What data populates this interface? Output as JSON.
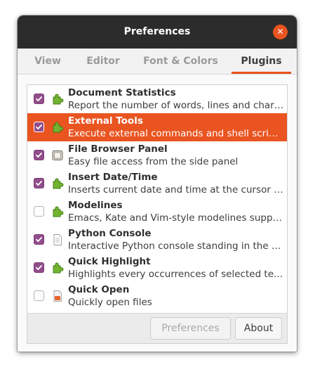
{
  "window": {
    "title": "Preferences"
  },
  "tabs": [
    {
      "label": "View",
      "active": false
    },
    {
      "label": "Editor",
      "active": false
    },
    {
      "label": "Font & Colors",
      "active": false
    },
    {
      "label": "Plugins",
      "active": true
    }
  ],
  "plugins": [
    {
      "name": "Document Statistics",
      "description": "Report the number of words, lines and characters",
      "enabled": true,
      "selected": false,
      "icon": "puzzle-icon"
    },
    {
      "name": "External Tools",
      "description": "Execute external commands and shell scripts.",
      "enabled": true,
      "selected": true,
      "icon": "puzzle-icon"
    },
    {
      "name": "File Browser Panel",
      "description": "Easy file access from the side panel",
      "enabled": true,
      "selected": false,
      "icon": "panel-icon"
    },
    {
      "name": "Insert Date/Time",
      "description": "Inserts current date and time at the cursor position.",
      "enabled": true,
      "selected": false,
      "icon": "puzzle-icon"
    },
    {
      "name": "Modelines",
      "description": "Emacs, Kate and Vim-style modelines support for gedit.",
      "enabled": false,
      "selected": false,
      "icon": "puzzle-icon"
    },
    {
      "name": "Python Console",
      "description": "Interactive Python console standing in the bottom panel",
      "enabled": true,
      "selected": false,
      "icon": "document-icon"
    },
    {
      "name": "Quick Highlight",
      "description": "Highlights every occurrences of selected text.",
      "enabled": true,
      "selected": false,
      "icon": "puzzle-icon"
    },
    {
      "name": "Quick Open",
      "description": "Quickly open files",
      "enabled": false,
      "selected": false,
      "icon": "folder-icon"
    }
  ],
  "buttons": {
    "preferences": "Preferences",
    "about": "About"
  },
  "colors": {
    "accent": "#e95420",
    "check": "#924d8b",
    "titlebar": "#2c2c2c",
    "puzzle": "#4e9a06"
  }
}
